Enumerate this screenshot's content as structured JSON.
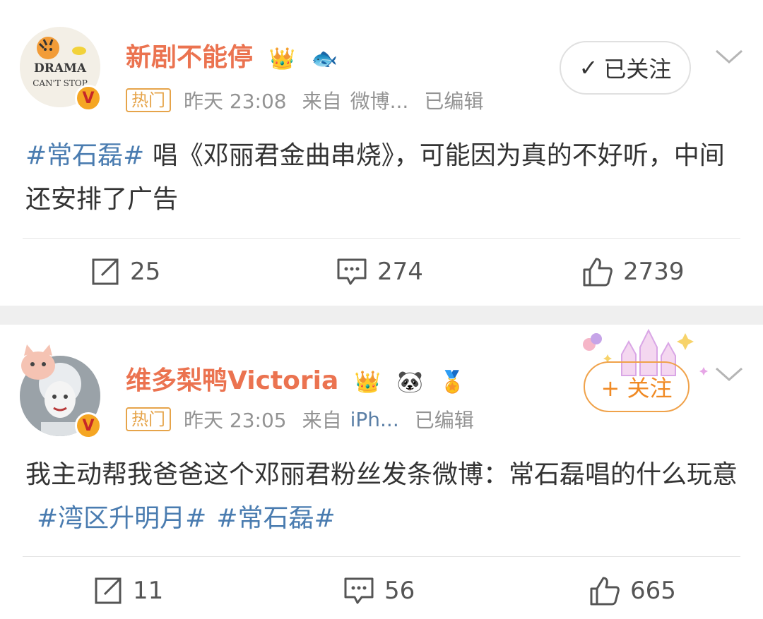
{
  "posts": [
    {
      "username": "新剧不能停",
      "hot_label": "热门",
      "time": "昨天 23:08",
      "source_prefix": "来自",
      "source": "微博...",
      "edited": "已编辑",
      "follow_label": "已关注",
      "avatar_text_1": "DRAMA",
      "avatar_text_2": "CAN'T STOP",
      "content_tag": "#常石磊#",
      "content_text": " 唱《邓丽君金曲串烧》，可能因为真的不好听，中间还安排了广告",
      "reposts": "25",
      "comments": "274",
      "likes": "2739"
    },
    {
      "username": "维多梨鸭Victoria",
      "hot_label": "热门",
      "time": "昨天 23:05",
      "source_prefix": "来自",
      "source": "iPh...",
      "edited": "已编辑",
      "follow_label": "+ 关注",
      "content_text": "我主动帮我爸爸这个邓丽君粉丝发条微博：常石磊唱的什么玩意 ",
      "content_tag1": "#湾区升明月#",
      "content_tag2": "#常石磊#",
      "reposts": "11",
      "comments": "56",
      "likes": "665"
    }
  ],
  "colors": {
    "accent": "#eb7350",
    "link": "#4a7cb0",
    "hot": "#e6a44a"
  }
}
